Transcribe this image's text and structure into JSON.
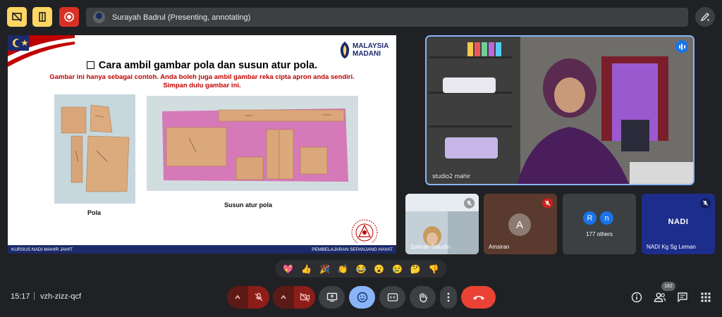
{
  "top_bar": {
    "presenter_status": "Surayah Badrul (Presenting, annotating)"
  },
  "slide": {
    "logo_line1": "MALAYSIA",
    "logo_line2": "MADANI",
    "title": "Cara ambil gambar pola dan susun atur  pola.",
    "subtitle_line1": "Gambar ini hanya sebagai contoh. Anda boleh juga ambil gambar reka cipta apron anda sendiri.",
    "subtitle_line2": "Simpan dulu gambar ini.",
    "caption_left": "Pola",
    "caption_right": "Susun atur pola",
    "emblem_text_top": "PERBADANAN KOMUNITI",
    "emblem_text_bottom": "NADI MAHIR",
    "footer_left": "KURSUS NADI MAHIR JAHIT",
    "footer_right": "PEMBELAJARAN SEPANJANG HAYAT"
  },
  "main_video": {
    "name": "studio2 mahir"
  },
  "tiles": [
    {
      "name": "Zahirah Saludin"
    },
    {
      "name": "Amsiran",
      "avatar_letter": "A"
    },
    {
      "label": "177 others",
      "avatar1": "R",
      "avatar2": "n"
    },
    {
      "name": "NADI Kg Sg Leman",
      "logo": "NADI"
    }
  ],
  "reactions": [
    "sparkling-heart",
    "thumbs-up",
    "party-popper",
    "clapping-hands",
    "joy",
    "open-mouth",
    "sad",
    "thinking",
    "thumbs-down"
  ],
  "bottom_bar": {
    "time": "15:17",
    "separator": "|",
    "meeting_code": "vzh-zizz-qcf",
    "people_count": "182"
  },
  "colors": {
    "background": "#202124",
    "accent_blue": "#8ab4f8",
    "end_call_red": "#ea4335",
    "muted_red": "#8c1d18",
    "slide_footer_navy": "#1b2a6b",
    "top_button_yellow": "#fdd663",
    "record_red": "#d93025"
  }
}
